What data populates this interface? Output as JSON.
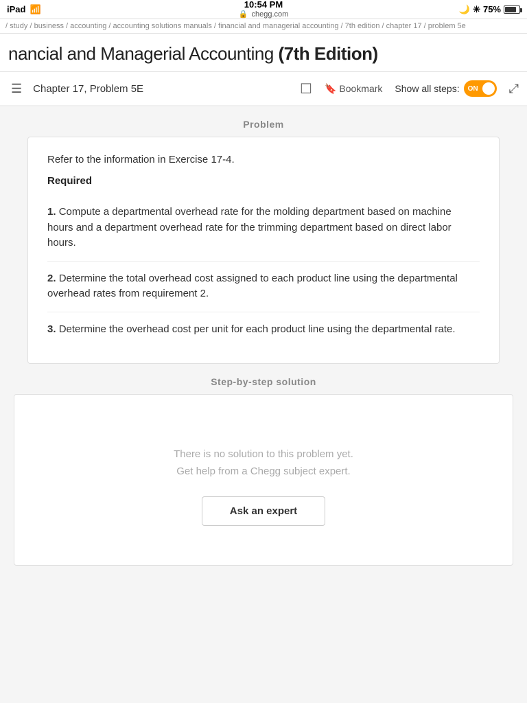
{
  "statusBar": {
    "device": "iPad",
    "time": "10:54 PM",
    "url": "chegg.com",
    "battery": "75%"
  },
  "breadcrumb": {
    "path": "/ study / business / accounting / accounting solutions manuals / financial and managerial accounting / 7th edition / chapter 17 / problem 5e"
  },
  "pageTitle": {
    "main": "nancial and Managerial Accounting",
    "edition": "(7th Edition)"
  },
  "toolbar": {
    "chapterLabel": "Chapter 17, Problem 5E",
    "bookmarkLabel": "Bookmark",
    "showStepsLabel": "Show all steps:",
    "toggleState": "ON",
    "expandLabel": "Expand"
  },
  "problem": {
    "sectionLabel": "Problem",
    "intro": "Refer to the information in Exercise 17-4.",
    "required": "Required",
    "items": [
      {
        "number": "1.",
        "text": "Compute a departmental overhead rate for the molding department based on machine hours and a department overhead rate for the trimming department based on direct labor hours."
      },
      {
        "number": "2.",
        "text": "Determine the total overhead cost assigned to each product line using the departmental overhead rates from requirement 2."
      },
      {
        "number": "3.",
        "text": "Determine the overhead cost per unit for each product line using the departmental rate."
      }
    ]
  },
  "solution": {
    "sectionLabel": "Step-by-step solution",
    "noSolutionText1": "There is no solution to this problem yet.",
    "noSolutionText2": "Get help from a Chegg subject expert.",
    "askExpertLabel": "Ask an expert"
  }
}
